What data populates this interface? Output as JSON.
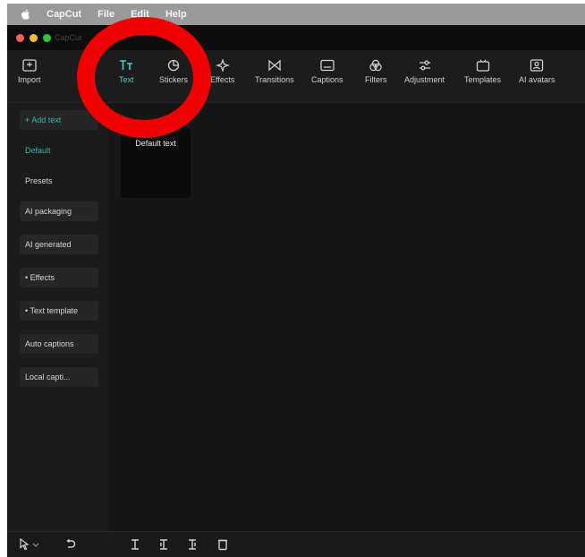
{
  "menubar": {
    "apple_icon": "apple-icon",
    "items": [
      "CapCut",
      "File",
      "Edit",
      "Help"
    ]
  },
  "window": {
    "app_name": "CapCut"
  },
  "toolbar": {
    "tabs": [
      {
        "label": "Import",
        "icon": "import-icon",
        "active": false
      },
      {
        "label": "Text",
        "icon": "text-icon",
        "active": true
      },
      {
        "label": "Stickers",
        "icon": "sticker-icon",
        "active": false
      },
      {
        "label": "Effects",
        "icon": "effects-icon",
        "active": false
      },
      {
        "label": "Transitions",
        "icon": "transitions-icon",
        "active": false
      },
      {
        "label": "Captions",
        "icon": "captions-icon",
        "active": false
      },
      {
        "label": "Filters",
        "icon": "filters-icon",
        "active": false
      },
      {
        "label": "Adjustment",
        "icon": "adjustment-icon",
        "active": false
      },
      {
        "label": "Templates",
        "icon": "templates-icon",
        "active": false
      },
      {
        "label": "AI avatars",
        "icon": "ai-avatar-icon",
        "active": false
      }
    ]
  },
  "sidebar": {
    "items": [
      {
        "label": "+ Add text"
      },
      {
        "label": "Default"
      },
      {
        "label": "Presets"
      },
      {
        "label": "AI packaging"
      },
      {
        "label": "AI generated"
      },
      {
        "label": "• Effects"
      },
      {
        "label": "• Text template"
      },
      {
        "label": "Auto captions"
      },
      {
        "label": "Local capti..."
      }
    ]
  },
  "main": {
    "cards": [
      {
        "label": "Default text"
      }
    ]
  },
  "colors": {
    "accent": "#3fd4c6",
    "annotation": "#f00000",
    "background": "#181818"
  },
  "bottombar": {
    "icons": [
      "pointer-icon",
      "chevron-down-icon",
      "undo-icon",
      "split-icon",
      "split-left-icon",
      "split-right-icon",
      "delete-icon"
    ]
  }
}
